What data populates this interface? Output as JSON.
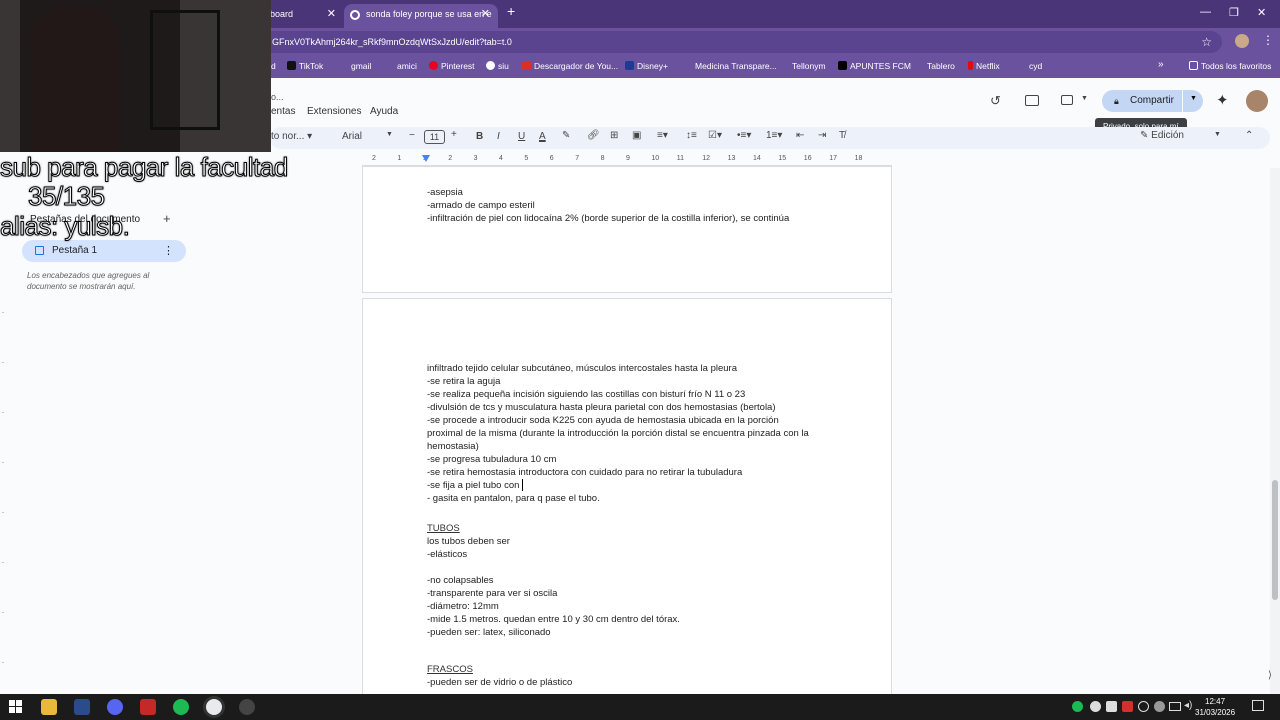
{
  "browser": {
    "tabs": [
      {
        "label": "board"
      },
      {
        "label": "sonda foley porque se usa en e"
      }
    ],
    "url": "GFnxV0TkAhmj264kr_sRkf9mnOzdqWtSxJzdU/edit?tab=t.0"
  },
  "bookmarks": [
    {
      "label": "d"
    },
    {
      "label": "TikTok"
    },
    {
      "label": "gmail"
    },
    {
      "label": "amici"
    },
    {
      "label": "Pinterest"
    },
    {
      "label": "siu"
    },
    {
      "label": "Descargador de You..."
    },
    {
      "label": "Disney+"
    },
    {
      "label": "Medicina Transpare..."
    },
    {
      "label": "Tellonym"
    },
    {
      "label": "APUNTES FCM"
    },
    {
      "label": "Tablero"
    },
    {
      "label": "Netflix"
    },
    {
      "label": "cyd"
    },
    {
      "label": "Todos los favoritos"
    }
  ],
  "docs": {
    "menus": [
      "o...",
      "entas",
      "Extensiones",
      "Ayuda"
    ],
    "share_label": "Compartir",
    "tooltip": "Privado, solo para mí",
    "edit_mode": "Edición"
  },
  "toolbar": {
    "style": "to nor...",
    "font": "Arial",
    "font_size": "11"
  },
  "ruler": [
    "2",
    "1",
    "1",
    "2",
    "3",
    "4",
    "5",
    "6",
    "7",
    "8",
    "9",
    "10",
    "11",
    "12",
    "13",
    "14",
    "15",
    "16",
    "17",
    "18"
  ],
  "sidebar": {
    "section_title": "Pestañas del documento",
    "tab_label": "Pestaña 1",
    "hint": "Los encabezados que agregues al documento se mostrarán aquí."
  },
  "overlay": {
    "line1": "sub para pagar la facultad",
    "line2": "35/135",
    "line3": "alias: yulsb."
  },
  "page1": [
    "-asepsia",
    "-armado de campo esteril",
    "-infiltración de piel con lidocaína 2% (borde superior de la costilla inferior), se continúa"
  ],
  "page2": {
    "procedure": [
      "infiltrado tejido celular subcutáneo, músculos intercostales hasta la pleura",
      "-se retira la aguja",
      "-se realiza pequeña incisión siguiendo las costillas con bisturí frío N 11 o 23",
      "-divulsión de tcs y musculatura hasta pleura parietal con dos hemostasias (bertola)",
      "-se procede a introducir soda K225 con ayuda de hemostasia ubicada en la porción",
      "proximal de la misma (durante la introducción la porción distal se encuentra pinzada con la",
      "hemostasia)",
      "-se progresa tubuladura 10 cm",
      "-se retira hemostasia introductora con cuidado para no retirar la tubuladura",
      "-se fija a piel tubo con",
      "- gasita en pantalon, para q pase el tubo."
    ],
    "tubos_heading": "TUBOS",
    "tubos": [
      "los tubos deben ser",
      "-elásticos",
      "",
      "-no colapsables",
      "-transparente para ver si oscila",
      "-diámetro: 12mm",
      "-mide 1.5 metros. quedan entre 10 y 30 cm dentro del tórax.",
      "-pueden ser: latex, siliconado"
    ],
    "frascos_heading": "FRASCOS",
    "frascos": [
      "-pueden ser de vidrio o de plástico"
    ]
  },
  "taskbar": {
    "time": "12:47",
    "date": "31/03/2026"
  }
}
